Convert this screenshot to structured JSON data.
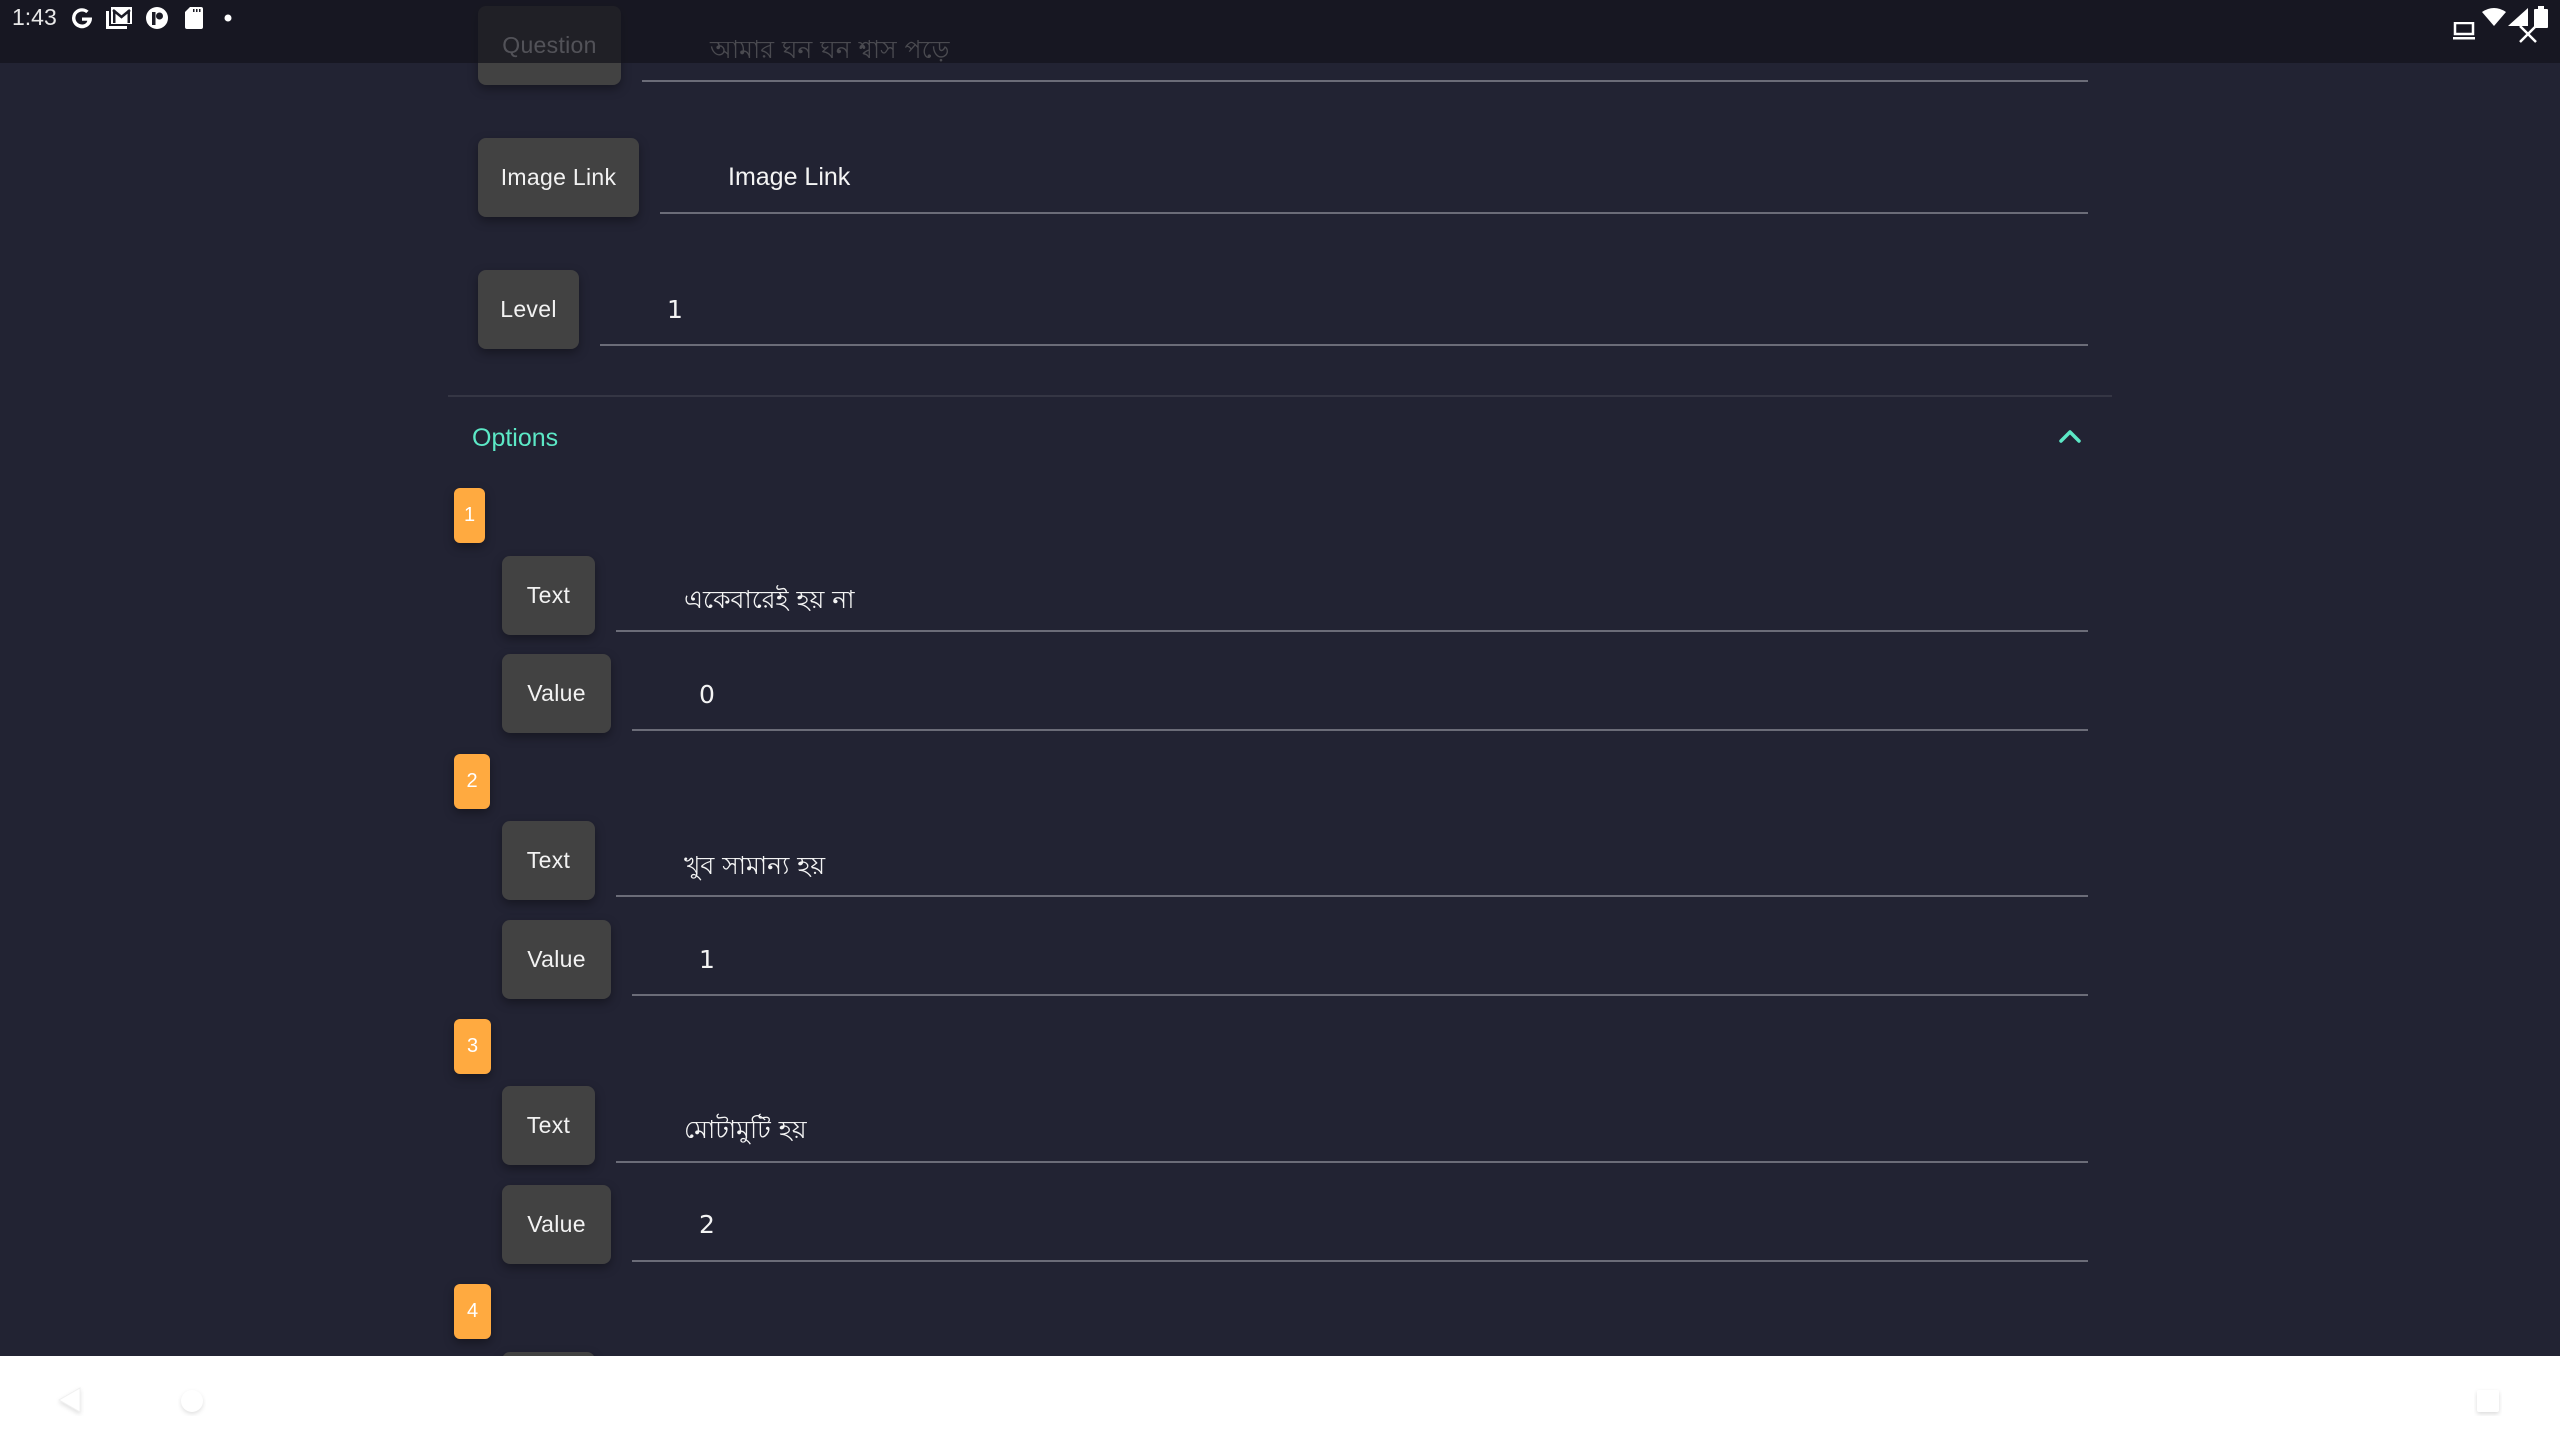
{
  "status_bar": {
    "time": "1:43",
    "left_icons": [
      "google-icon",
      "gmail-icon",
      "app-notification-icon",
      "sd-card-icon",
      "more-notifications-dot-icon"
    ],
    "right_icons": [
      "cast-screen-icon",
      "wifi-icon",
      "cellular-signal-icon",
      "battery-icon",
      "close-icon"
    ]
  },
  "form": {
    "question": {
      "label": "Question",
      "value": "আমার ঘন ঘন শ্বাস পড়ে"
    },
    "image_link": {
      "label": "Image Link",
      "placeholder": "Image Link",
      "value": ""
    },
    "level": {
      "label": "Level",
      "value": "1"
    }
  },
  "options_section": {
    "title": "Options",
    "expanded": true,
    "accent_color": "#5ce8c6",
    "badge_color": "#ffaa40",
    "items": [
      {
        "number": "1",
        "text_label": "Text",
        "text": "একেবারেই হয় না",
        "value_label": "Value",
        "value": "0"
      },
      {
        "number": "2",
        "text_label": "Text",
        "text": "খুব সামান্য হয়",
        "value_label": "Value",
        "value": "1"
      },
      {
        "number": "3",
        "text_label": "Text",
        "text": "মোটামুটি হয়",
        "value_label": "Value",
        "value": "2"
      },
      {
        "number": "4"
      }
    ]
  },
  "nav_bar": {
    "buttons": [
      "back",
      "home",
      "recents"
    ]
  }
}
